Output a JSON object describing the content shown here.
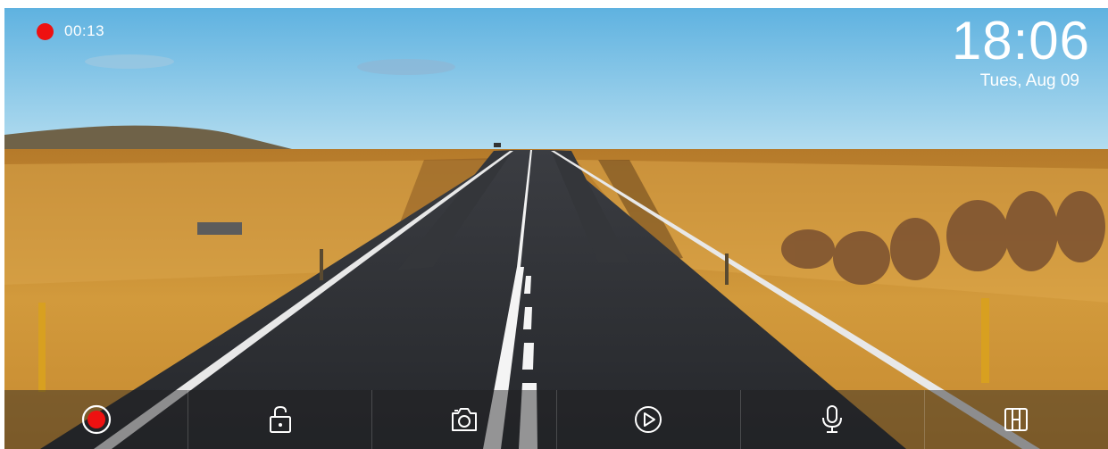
{
  "status": {
    "recording_time": "00:13"
  },
  "clock": {
    "time": "18:06",
    "date": "Tues, Aug 09"
  },
  "toolbar": {
    "buttons": [
      {
        "name": "record-button",
        "icon": "record-icon"
      },
      {
        "name": "lock-button",
        "icon": "unlock-icon"
      },
      {
        "name": "snapshot-button",
        "icon": "camera-icon"
      },
      {
        "name": "playback-button",
        "icon": "play-icon"
      },
      {
        "name": "microphone-button",
        "icon": "microphone-icon"
      },
      {
        "name": "split-view-button",
        "icon": "split-view-icon"
      }
    ]
  },
  "colors": {
    "record_red": "#ee1111",
    "sky": "#87c6e4",
    "field": "#c98a2c",
    "road": "#2f3135"
  }
}
